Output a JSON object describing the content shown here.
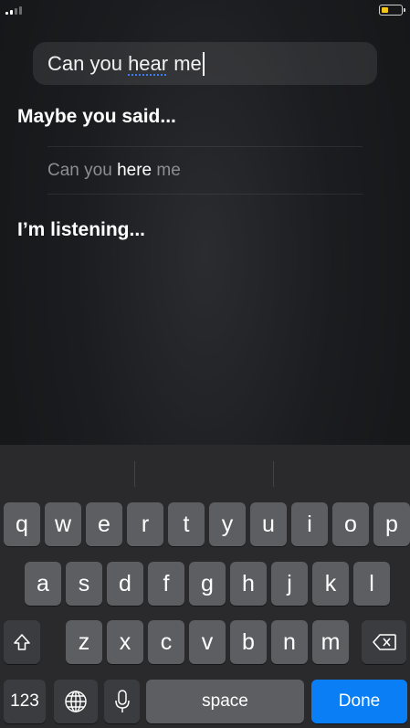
{
  "status_bar": {
    "battery_level": 0.35,
    "battery_color": "#f5c518",
    "signal_bars": 4,
    "signal_active": 2
  },
  "query": {
    "before": "Can you ",
    "emphasis": "hear",
    "after": " me"
  },
  "maybe_heading": "Maybe you said...",
  "suggestion": {
    "before": "Can you ",
    "highlight": "here",
    "after": " me"
  },
  "listening_label": "I’m listening...",
  "keyboard": {
    "row1": [
      "q",
      "w",
      "e",
      "r",
      "t",
      "y",
      "u",
      "i",
      "o",
      "p"
    ],
    "row2": [
      "a",
      "s",
      "d",
      "f",
      "g",
      "h",
      "j",
      "k",
      "l"
    ],
    "row3": [
      "z",
      "x",
      "c",
      "v",
      "b",
      "n",
      "m"
    ],
    "numbers_label": "123",
    "space_label": "space",
    "done_label": "Done",
    "done_color": "#0a7ff5",
    "icons": {
      "shift": "shift-icon",
      "delete": "delete-icon",
      "globe": "globe-icon",
      "mic": "microphone-icon"
    }
  }
}
